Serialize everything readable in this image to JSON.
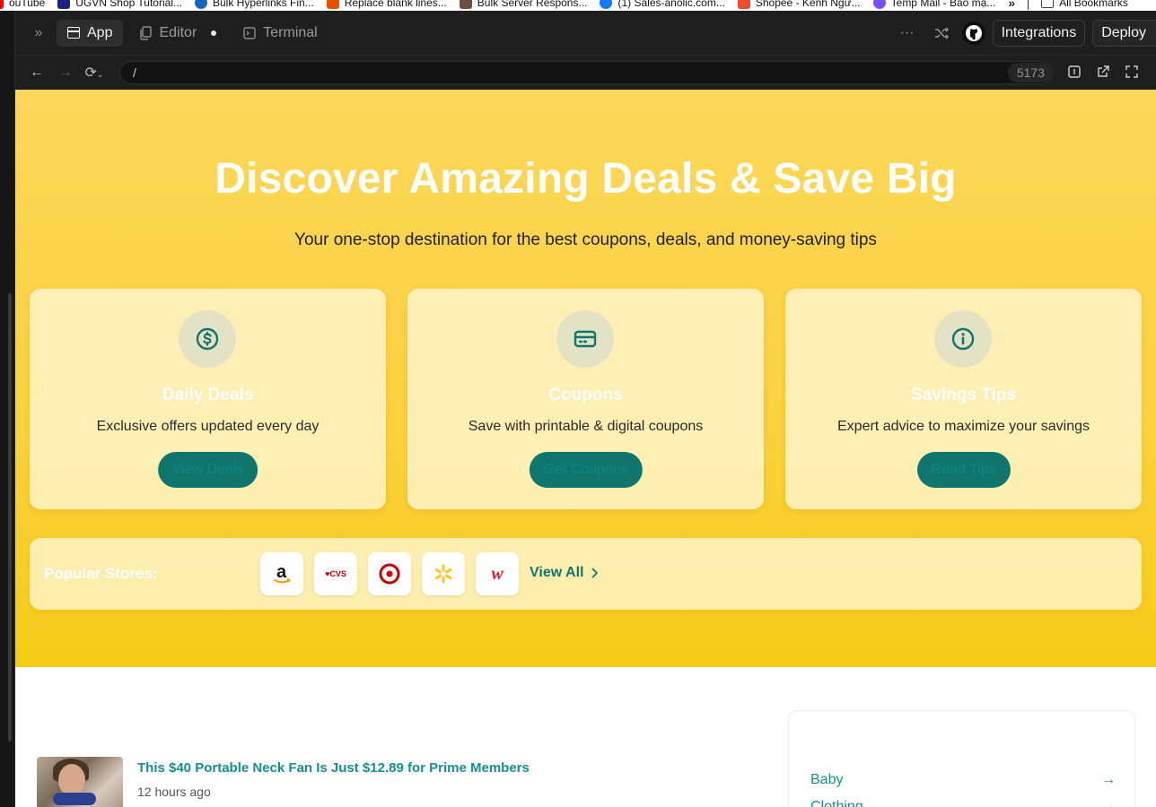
{
  "bookmarks": [
    {
      "label": "ouTube",
      "color": "#ff0000"
    },
    {
      "label": "UGVN Shop Tutorial...",
      "color": "#1a237e"
    },
    {
      "label": "Bulk Hyperlinks Fin...",
      "color": "#1565c0"
    },
    {
      "label": "Replace blank lines...",
      "color": "#e65100"
    },
    {
      "label": "Bulk Server Respons...",
      "color": "#6d4c41"
    },
    {
      "label": "(1) Sales-anolic.com...",
      "color": "#1877f2"
    },
    {
      "label": "Shopee - Kênh Ngư...",
      "color": "#ee4d2d"
    },
    {
      "label": "Temp Mail - Bảo mậ...",
      "color": "#7c4dff"
    }
  ],
  "bookmarks_more": "»",
  "bookmarks_all": "All Bookmarks",
  "tabs": {
    "app": "App",
    "editor": "Editor",
    "terminal": "Terminal"
  },
  "toolbar": {
    "integrations": "Integrations",
    "deploy": "Deploy"
  },
  "url": {
    "path": "/",
    "port": "5173"
  },
  "hero": {
    "title": "Discover Amazing Deals & Save Big",
    "subtitle": "Your one-stop destination for the best coupons, deals, and money-saving tips"
  },
  "cards": [
    {
      "title": "Daily Deals",
      "desc": "Exclusive offers updated every day",
      "button": "View Deals",
      "icon": "dollar-icon"
    },
    {
      "title": "Coupons",
      "desc": "Save with printable & digital coupons",
      "button": "Get Coupons",
      "icon": "card-icon"
    },
    {
      "title": "Savings Tips",
      "desc": "Expert advice to maximize your savings",
      "button": "Read Tips",
      "icon": "info-icon"
    }
  ],
  "stores": {
    "label": "Popular Stores:",
    "items": [
      {
        "name": "amazon",
        "text": "a"
      },
      {
        "name": "cvs",
        "text": "♥CVS"
      },
      {
        "name": "target",
        "text": ""
      },
      {
        "name": "walmart",
        "text": ""
      },
      {
        "name": "walgreens",
        "text": "w"
      }
    ],
    "view_all": "View All"
  },
  "post": {
    "title": "This $40 Portable Neck Fan Is Just $12.89 for Prime Members",
    "time": "12 hours ago"
  },
  "categories": [
    {
      "label": "Baby",
      "arrow": "→"
    },
    {
      "label": "Clothing",
      "arrow": "→"
    }
  ],
  "colors": {
    "accent": "#0f766e",
    "link": "#16908a",
    "hero": "#fbd13c"
  }
}
